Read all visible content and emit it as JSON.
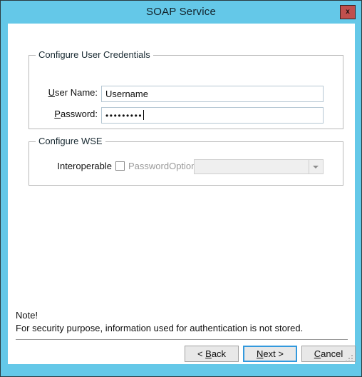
{
  "window": {
    "title": "SOAP Service",
    "close_label": "x",
    "titlebar_color": "#64c8e8",
    "close_button_color": "#c0504d"
  },
  "groups": {
    "credentials": {
      "legend": "Configure User Credentials",
      "fields": {
        "username": {
          "label_prefix": "",
          "label_accesskey": "U",
          "label_rest": "ser Name:",
          "value": "Username",
          "placeholder": ""
        },
        "password": {
          "label_accesskey": "P",
          "label_rest": "assword:",
          "value": "•••••••••",
          "masked_length": 9,
          "placeholder": ""
        }
      }
    },
    "wse": {
      "legend": "Configure WSE",
      "interoperable_label": "Interoperable",
      "checkbox_label": "PasswordOptions",
      "checkbox_checked": false,
      "checkbox_disabled": true,
      "dropdown_value": "",
      "dropdown_disabled": true,
      "dropdown_icon": "chevron-down-icon"
    }
  },
  "note": {
    "title": "Note!",
    "body": "For security purpose, information used for authentication is not stored."
  },
  "footer": {
    "back": {
      "accesskey": "B",
      "prefix": "< ",
      "rest": "ack",
      "suffix": ""
    },
    "next": {
      "accesskey": "N",
      "prefix": "",
      "rest": "ext >",
      "focused": true
    },
    "cancel": {
      "accesskey": "C",
      "prefix": "",
      "rest": "ancel"
    }
  }
}
